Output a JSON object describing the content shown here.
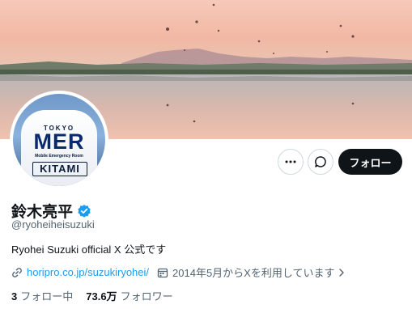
{
  "profile": {
    "display_name": "鈴木亮平",
    "handle": "@ryoheiheisuzuki",
    "bio": "Ryohei Suzuki official X  公式です",
    "link": "horipro.co.jp/suzukiryohei/",
    "joined": "2014年5月からXを利用しています"
  },
  "avatar": {
    "line1": "TOKYO",
    "line2": "MER",
    "line3": "Mobile Emergency Room",
    "line4": "KITAMI"
  },
  "actions": {
    "follow_label": "フォロー"
  },
  "stats": {
    "following_count": "3",
    "following_label": "フォロー中",
    "followers_count": "73.6万",
    "followers_label": "フォロワー"
  },
  "icons": {
    "more": "more-icon",
    "message": "message-icon",
    "verified": "verified-badge-icon",
    "link": "link-icon",
    "calendar": "calendar-icon"
  },
  "colors": {
    "accent": "#1d9bf0",
    "text": "#0f1419",
    "muted": "#536471",
    "button_dark": "#0f1419"
  }
}
